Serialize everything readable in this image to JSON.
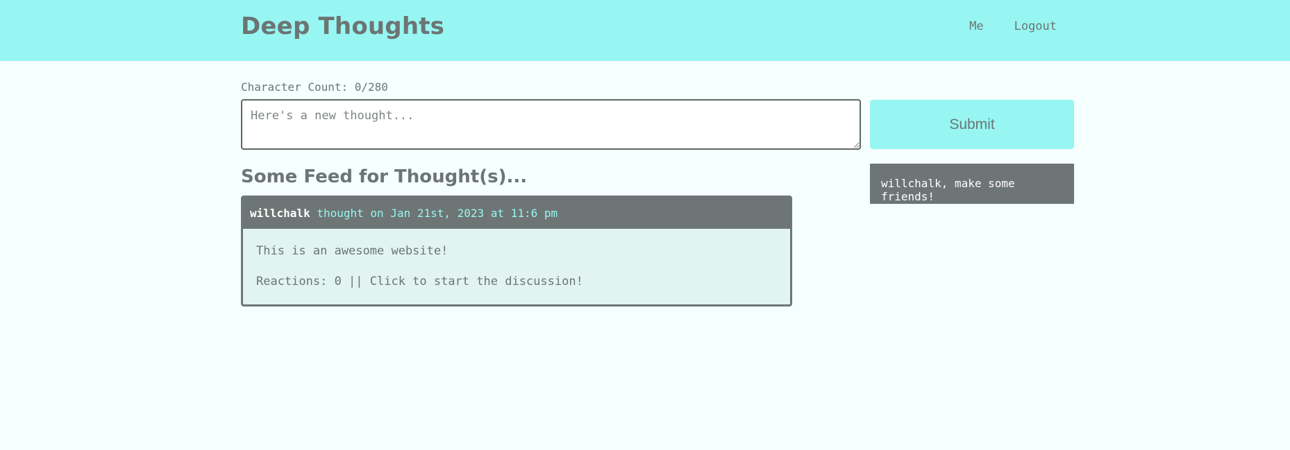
{
  "header": {
    "title": "Deep Thoughts",
    "nav": {
      "me": "Me",
      "logout": "Logout"
    }
  },
  "form": {
    "char_count": "Character Count: 0/280",
    "placeholder": "Here's a new thought...",
    "value": "",
    "submit_label": "Submit"
  },
  "friends": {
    "message": "willchalk, make some friends!"
  },
  "feed": {
    "title": "Some Feed for Thought(s)...",
    "thoughts": [
      {
        "username": "willchalk",
        "date_text": "thought on Jan 21st, 2023 at 11:6 pm",
        "text": "This is an awesome website!",
        "reactions_text": "Reactions: 0 || Click to start the discussion!"
      }
    ]
  },
  "colors": {
    "accent": "#97f6f1",
    "dark": "#6e7575",
    "background": "#f5fffd",
    "card_body": "#e1f4f2"
  }
}
